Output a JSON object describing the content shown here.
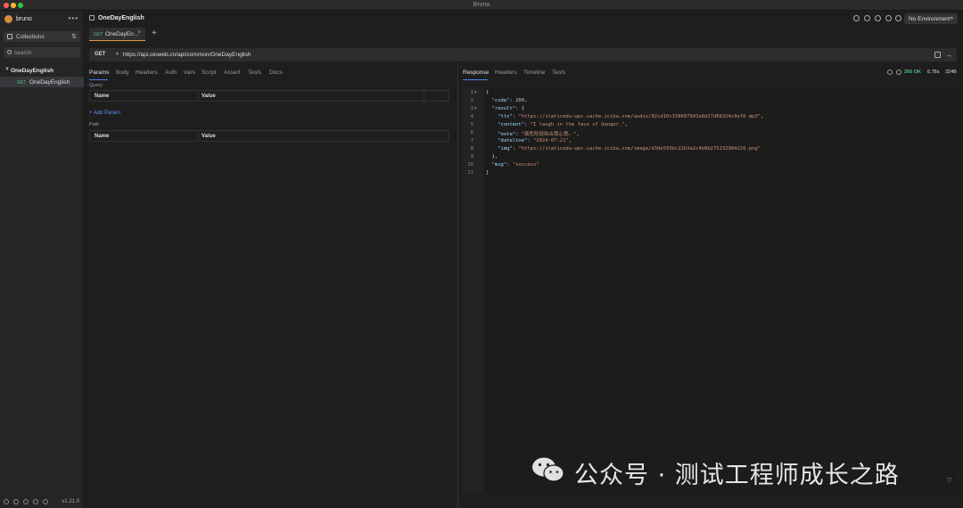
{
  "window": {
    "title": "Bruno"
  },
  "sidebar": {
    "brand": "bruno",
    "more": "•••",
    "collections_label": "Collections",
    "sort_icon": "⇅",
    "search_placeholder": "search",
    "collection_name": "OneDayEnglish",
    "requests": [
      {
        "method": "GET",
        "name": "OneDayEnglish"
      }
    ],
    "version": "v1.21.0"
  },
  "topbar": {
    "collection_name": "OneDayEnglish",
    "environment": "No Environment"
  },
  "tab": {
    "method": "GET",
    "name": "OneDayEn...",
    "close": "×",
    "add": "+"
  },
  "url_bar": {
    "method": "GET",
    "url": "https://api.oioweb.cn/api/common/OneDayEnglish",
    "send": "→"
  },
  "request_tabs": [
    "Params",
    "Body",
    "Headers",
    "Auth",
    "Vars",
    "Script",
    "Assert",
    "Tests",
    "Docs"
  ],
  "params": {
    "query_label": "Query",
    "path_label": "Path",
    "columns": [
      "Name",
      "Value"
    ],
    "add_param": "+ Add Param"
  },
  "response_tabs": [
    "Response",
    "Headers",
    "Timeline",
    "Tests"
  ],
  "response_meta": {
    "status": "200 OK",
    "time": "6.78s",
    "size": "324B"
  },
  "response_body": {
    "line_numbers": [
      "1",
      "2",
      "3",
      "4",
      "5",
      "6",
      "7",
      "8",
      "9",
      "10",
      "11"
    ],
    "lines": [
      "{",
      "  \"code\": 200,",
      "  \"result\": {",
      "    \"tts\": \"https://staticedu-wps.cache.iciba.com/audio/82cd10c158687943a0d27d66324c9ef0.mp3\",",
      "    \"content\": \"I laugh in the face of danger.\",",
      "    \"note\": \"面危险就纵合我心意。\",",
      "    \"dateline\": \"2024-07-21\",",
      "    \"img\": \"https://staticedu-wps.cache.iciba.com/image/d3de593bc22b3a2c4b8b275232984220.png\"",
      "  },",
      "  \"msg\": \"success\"",
      "}"
    ]
  },
  "watermark": {
    "text": "公众号 · 测试工程师成长之路"
  }
}
